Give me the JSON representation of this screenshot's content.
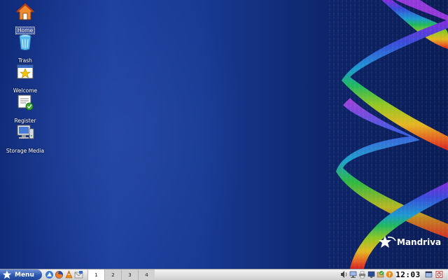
{
  "desktop": {
    "icons": [
      {
        "label": "Home",
        "icon": "home-icon",
        "selected": true
      },
      {
        "label": "Trash",
        "icon": "trash-icon"
      },
      {
        "label": "Welcome",
        "icon": "welcome-icon"
      },
      {
        "label": "Register",
        "icon": "register-icon"
      },
      {
        "label": "Storage Media",
        "icon": "storage-media-icon"
      }
    ],
    "brand": "Mandriva"
  },
  "taskbar": {
    "menu_label": "Menu",
    "quick_launch": [
      "konqueror-icon",
      "firefox-icon",
      "vlc-icon",
      "kmail-icon"
    ],
    "pager": [
      "1",
      "2",
      "3",
      "4"
    ],
    "active_desktop": "1",
    "tray": [
      "volume-icon",
      "network-icon",
      "printer-icon",
      "monitor-icon",
      "updates-icon",
      "help-icon"
    ],
    "clock": "12:03",
    "right_buttons": [
      "show-desktop-icon",
      "logout-icon"
    ]
  },
  "colors": {
    "wallpaper_blue": "#183a93",
    "menu_blue": "#2d58b0",
    "taskbar_grey": "#dedede"
  }
}
